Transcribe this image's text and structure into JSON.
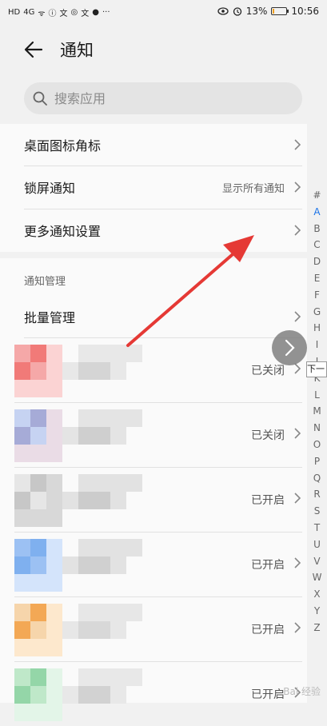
{
  "status_bar": {
    "left_items": [
      "HD",
      "4G",
      "ᯤ",
      "ⓘ",
      "文",
      "◎",
      "文",
      "●",
      "···"
    ],
    "battery_text": "13%",
    "battery_level": 0.13,
    "time": "10:56",
    "battery_color": "#f0a020"
  },
  "header": {
    "title": "通知"
  },
  "search": {
    "placeholder": "搜索应用"
  },
  "settings": [
    {
      "label": "桌面图标角标",
      "value": ""
    },
    {
      "label": "锁屏通知",
      "value": "显示所有通知"
    },
    {
      "label": "更多通知设置",
      "value": ""
    }
  ],
  "management": {
    "section_label": "通知管理",
    "batch_label": "批量管理"
  },
  "apps": [
    {
      "status": "已关闭",
      "colors": [
        "#f5a8a8",
        "#f17a78",
        "#fbd3d3",
        "#e8e8e8",
        "#d5d5d5"
      ]
    },
    {
      "status": "已关闭",
      "colors": [
        "#c6d3f2",
        "#a6abd7",
        "#eadce6",
        "#e4e4e4",
        "#cfcfcf"
      ]
    },
    {
      "status": "已开启",
      "colors": [
        "#e6e6e6",
        "#c7c7c7",
        "#d8d8d8",
        "#e2e2e2",
        "#cccccc"
      ]
    },
    {
      "status": "已开启",
      "colors": [
        "#9cc1f3",
        "#7fb0ef",
        "#d4e4fb",
        "#e2e2e2",
        "#d0d0d0"
      ]
    },
    {
      "status": "已开启",
      "colors": [
        "#f6d5ab",
        "#f3a855",
        "#fde8cd",
        "#e7e7e7",
        "#d8d8d8"
      ]
    },
    {
      "status": "已开启",
      "colors": [
        "#bfe8c9",
        "#94d6a8",
        "#e3f5e8",
        "#e8e8e8",
        "#d2d2d2"
      ]
    }
  ],
  "alpha_index": [
    "#",
    "A",
    "B",
    "C",
    "D",
    "E",
    "F",
    "G",
    "H",
    "I",
    "J",
    "K",
    "L",
    "M",
    "N",
    "O",
    "P",
    "Q",
    "R",
    "S",
    "T",
    "U",
    "V",
    "W",
    "X",
    "Y",
    "Z"
  ],
  "alpha_active": "A",
  "tooltip": {
    "text": "下一"
  },
  "watermark": "Bai 经验",
  "annotation_color": "#e53935"
}
